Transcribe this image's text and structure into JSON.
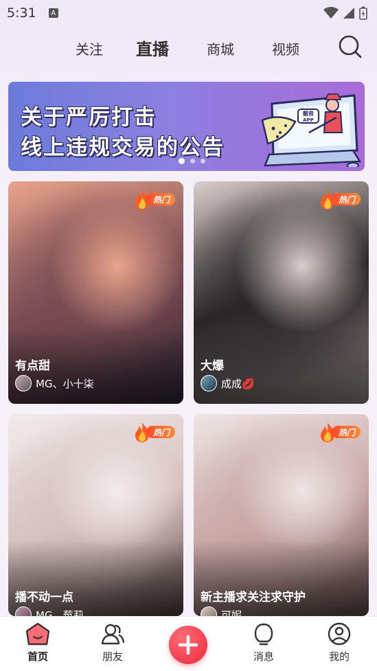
{
  "status_bar": {
    "time": "5:31",
    "notification_icon": "A"
  },
  "top_nav": {
    "tabs": [
      {
        "label": "关注",
        "active": false
      },
      {
        "label": "直播",
        "active": true
      },
      {
        "label": "商城",
        "active": false
      },
      {
        "label": "视频",
        "active": false
      }
    ],
    "search_icon": "search-icon"
  },
  "banner": {
    "line1": "关于严厉打击",
    "line2": "线上违规交易的公告",
    "app_badge": "靓音APP",
    "page_count": 3,
    "active_page": 1
  },
  "live_cards": [
    {
      "title": "有点甜",
      "host": "MG、小十柒",
      "hot_badge": "热门",
      "colors": [
        "#e9a48a",
        "#7a4b54",
        "#2b2430"
      ]
    },
    {
      "title": "大爆",
      "host": "成成💋",
      "hot_badge": "热门",
      "colors": [
        "#d7cfcc",
        "#2a2628",
        "#8f8686"
      ]
    },
    {
      "title": "播不动一点",
      "host": "MG、莓莉",
      "hot_badge": "热门",
      "colors": [
        "#f1ecec",
        "#d6c2c0",
        "#4a3a3a"
      ]
    },
    {
      "title": "新主播求关注求守护",
      "host": "可妮",
      "hot_badge": "热门",
      "colors": [
        "#ede5e5",
        "#c9a8a5",
        "#5a4646"
      ]
    }
  ],
  "bottom_nav": {
    "items": [
      {
        "label": "首页",
        "active": true,
        "icon": "home-icon"
      },
      {
        "label": "朋友",
        "active": false,
        "icon": "friends-icon"
      },
      {
        "label": "消息",
        "active": false,
        "icon": "message-icon"
      },
      {
        "label": "我的",
        "active": false,
        "icon": "profile-icon"
      }
    ],
    "add_icon": "plus-icon"
  },
  "colors": {
    "accent": "#ec2a3a",
    "hot_badge": "#ff5a2f",
    "text": "#333333"
  }
}
